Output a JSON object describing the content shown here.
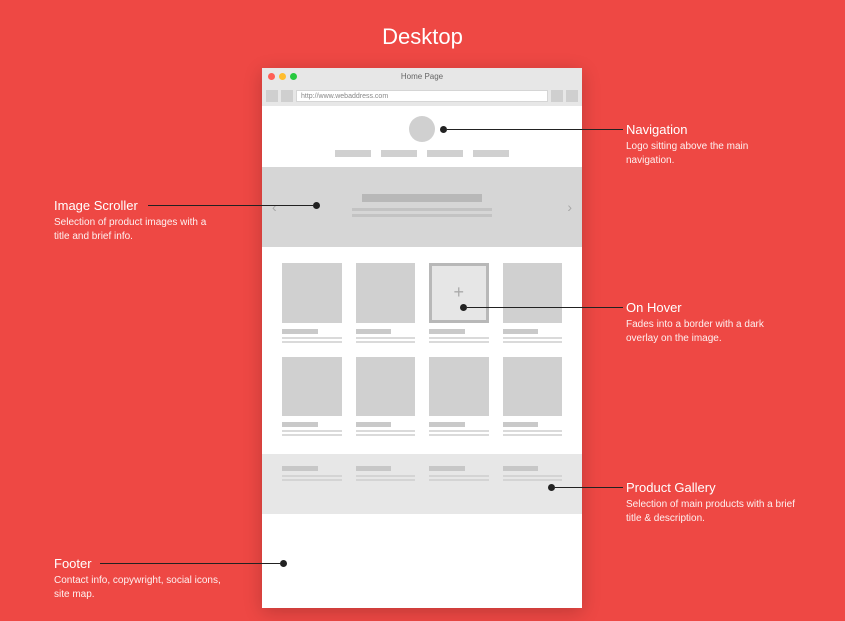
{
  "title": "Desktop",
  "browser": {
    "tab_title": "Home Page",
    "url": "http://www.webaddress.com"
  },
  "hover_glyph": "+",
  "arrows": {
    "prev": "‹",
    "next": "›"
  },
  "annotations": {
    "navigation": {
      "title": "Navigation",
      "desc": "Logo sitting above the main navigation."
    },
    "image_scroller": {
      "title": "Image Scroller",
      "desc": "Selection of product images with a title and brief info."
    },
    "on_hover": {
      "title": "On Hover",
      "desc": "Fades into a border with a dark overlay on the image."
    },
    "product_gallery": {
      "title": "Product Gallery",
      "desc": "Selection of main products with a brief title & description."
    },
    "footer": {
      "title": "Footer",
      "desc": "Contact info, copywright, social icons, site map."
    }
  }
}
